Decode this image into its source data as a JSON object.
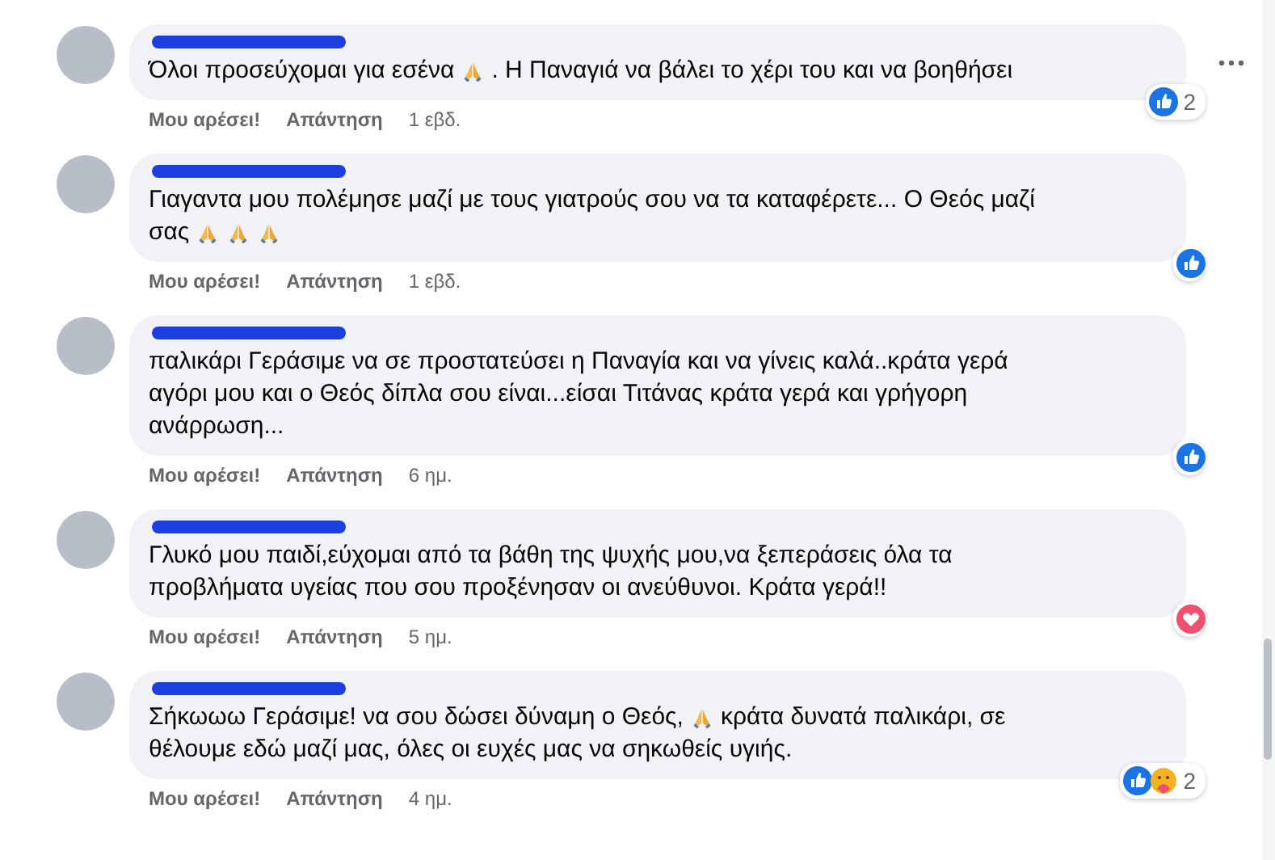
{
  "comments": [
    {
      "lines": [
        [
          {
            "kind": "text",
            "text": "Όλοι προσεύχομαι για εσένα"
          },
          {
            "kind": "pray"
          },
          {
            "kind": "text",
            "text": ". Η Παναγιά να βάλει το χέρι του και να βοηθήσει"
          }
        ]
      ],
      "actions": [
        "Μου αρέσει!",
        "Απάντηση",
        "1 εβδ."
      ],
      "reactions": [
        {
          "kind": "like"
        }
      ],
      "reaction_count": "2",
      "menu": true
    },
    {
      "lines": [
        [
          {
            "kind": "text",
            "text": "Γιαγαντα μου πολέμησε μαζί με τους γιατρούς σου να τα καταφέρετε... Ο Θεός μαζί"
          }
        ],
        [
          {
            "kind": "text",
            "text": "σας"
          },
          {
            "kind": "pray"
          },
          {
            "kind": "pray"
          },
          {
            "kind": "pray"
          }
        ]
      ],
      "actions": [
        "Μου αρέσει!",
        "Απάντηση",
        "1 εβδ."
      ],
      "reactions": [
        {
          "kind": "like"
        }
      ],
      "menu": false
    },
    {
      "lines": [
        [
          {
            "kind": "text",
            "text": "παλικάρι Γεράσιμε να σε προστατεύσει η Παναγία και να γίνεις καλά..κράτα γερά"
          }
        ],
        [
          {
            "kind": "text",
            "text": "αγόρι μου και ο Θεός δίπλα σου είναι...είσαι Τιτάνας κράτα γερά και γρήγορη"
          }
        ],
        [
          {
            "kind": "text",
            "text": "ανάρρωση..."
          }
        ]
      ],
      "actions": [
        "Μου αρέσει!",
        "Απάντηση",
        "6 ημ."
      ],
      "reactions": [
        {
          "kind": "like"
        }
      ],
      "menu": false
    },
    {
      "lines": [
        [
          {
            "kind": "text",
            "text": "Γλυκό μου παιδί,εύχομαι από τα βάθη της ψυχής μου,να ξεπεράσεις όλα τα"
          }
        ],
        [
          {
            "kind": "text",
            "text": "προβλήματα υγείας που σου προξένησαν οι ανεύθυνοι. Κράτα γερά!!"
          }
        ]
      ],
      "actions": [
        "Μου αρέσει!",
        "Απάντηση",
        "5 ημ."
      ],
      "reactions": [
        {
          "kind": "heart"
        }
      ],
      "menu": false
    },
    {
      "lines": [
        [
          {
            "kind": "text",
            "text": "Σήκωωω Γεράσιμε! να σου δώσει δύναμη ο Θεός,"
          },
          {
            "kind": "pray"
          },
          {
            "kind": "text",
            "text": "κράτα δυνατά παλικάρι, σε"
          }
        ],
        [
          {
            "kind": "text",
            "text": "θέλουμε εδώ μαζί μας, όλες οι ευχές μας να σηκωθείς υγιής."
          }
        ]
      ],
      "actions": [
        "Μου αρέσει!",
        "Απάντηση",
        "4 ημ."
      ],
      "reactions": [
        {
          "kind": "like"
        },
        {
          "kind": "care"
        }
      ],
      "reaction_count": "2",
      "menu": false
    }
  ]
}
